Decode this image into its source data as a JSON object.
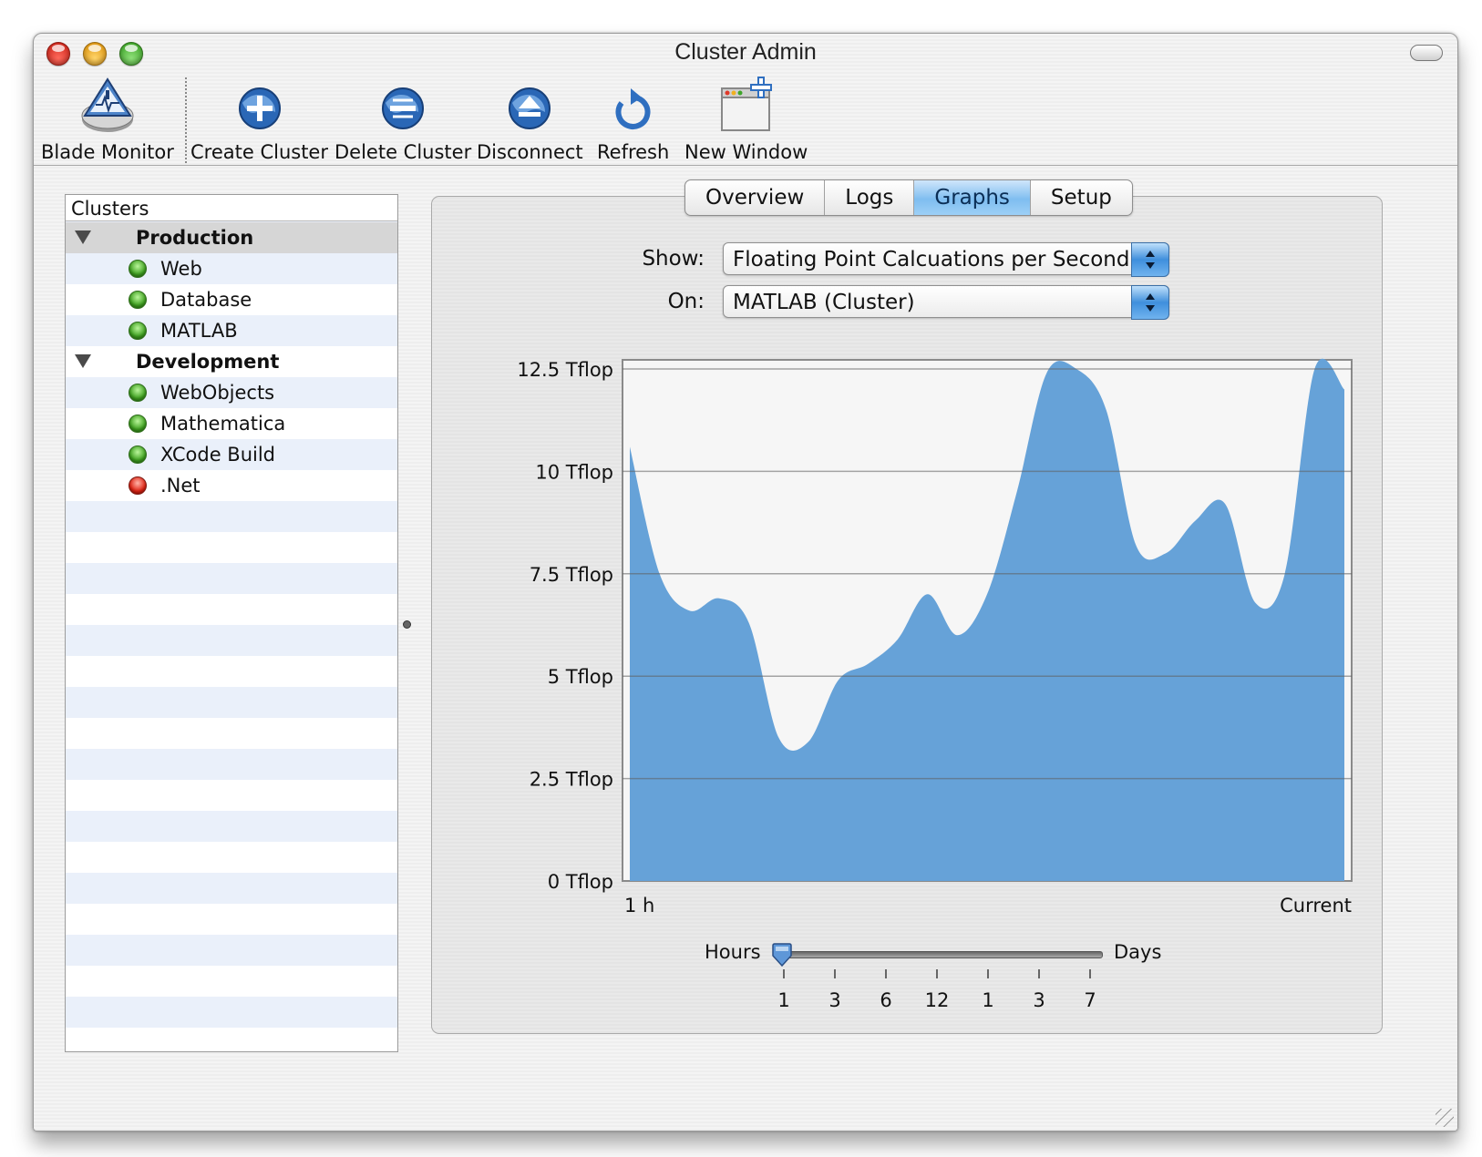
{
  "window": {
    "title": "Cluster Admin"
  },
  "toolbar": {
    "blade_monitor": "Blade Monitor",
    "create_cluster": "Create Cluster",
    "delete_cluster": "Delete Cluster",
    "disconnect": "Disconnect",
    "refresh": "Refresh",
    "new_window": "New Window"
  },
  "sidebar": {
    "header": "Clusters",
    "groups": [
      {
        "label": "Production",
        "items": [
          {
            "label": "Web",
            "status": "green"
          },
          {
            "label": "Database",
            "status": "green"
          },
          {
            "label": "MATLAB",
            "status": "green"
          }
        ]
      },
      {
        "label": "Development",
        "items": [
          {
            "label": "WebObjects",
            "status": "green"
          },
          {
            "label": "Mathematica",
            "status": "green"
          },
          {
            "label": "XCode Build",
            "status": "green"
          },
          {
            "label": ".Net",
            "status": "red"
          }
        ]
      }
    ]
  },
  "tabs": [
    "Overview",
    "Logs",
    "Graphs",
    "Setup"
  ],
  "active_tab": "Graphs",
  "controls": {
    "show_label": "Show:",
    "show_value": "Floating Point Calcuations per Second",
    "on_label": "On:",
    "on_value": "MATLAB (Cluster)"
  },
  "chart_data": {
    "type": "area",
    "title": "",
    "xlabel": "",
    "ylabel": "",
    "ylim": [
      0,
      12.5
    ],
    "yticks": [
      {
        "value": 0,
        "label": "0 Tflop"
      },
      {
        "value": 2.5,
        "label": "2.5 Tflop"
      },
      {
        "value": 5,
        "label": "5 Tflop"
      },
      {
        "value": 7.5,
        "label": "7.5 Tflop"
      },
      {
        "value": 10,
        "label": "10 Tflop"
      },
      {
        "value": 12.5,
        "label": "12.5 Tflop"
      }
    ],
    "x_start_label": "1 h",
    "x_end_label": "Current",
    "grid": true,
    "color": "#66a2d8",
    "series": [
      {
        "values": [
          10.6,
          7.5,
          6.6,
          6.9,
          6.3,
          3.5,
          3.4,
          4.9,
          5.3,
          5.9,
          7.0,
          6.0,
          7.0,
          9.5,
          12.4,
          12.5,
          11.5,
          8.2,
          8.0,
          8.8,
          9.2,
          6.8,
          7.5,
          12.5,
          12.0
        ]
      }
    ]
  },
  "slider": {
    "min_label": "Hours",
    "max_label": "Days",
    "ticks": [
      "1",
      "3",
      "6",
      "12",
      "1",
      "3",
      "7"
    ],
    "selected_index": 0
  }
}
